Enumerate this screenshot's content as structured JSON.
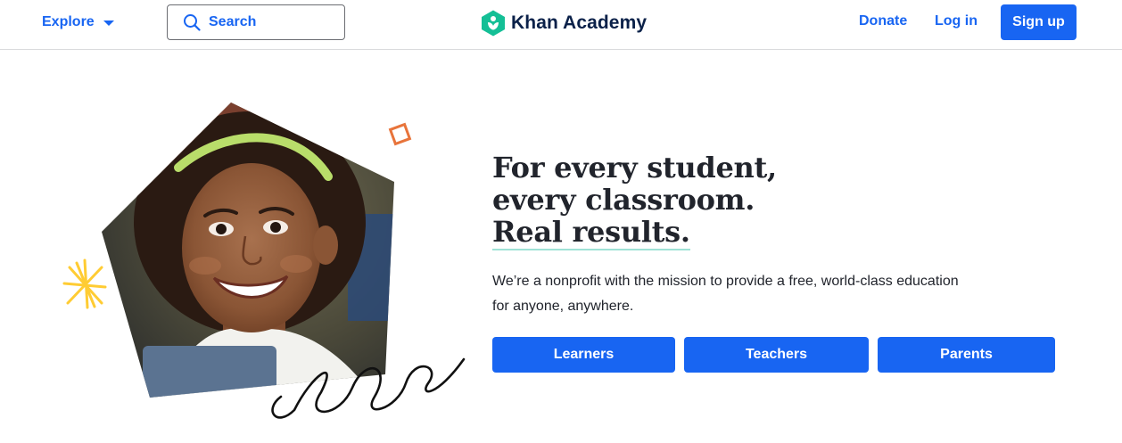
{
  "header": {
    "explore_label": "Explore",
    "search_label": "Search",
    "logo_text": "Khan Academy",
    "donate_label": "Donate",
    "login_label": "Log in",
    "signup_label": "Sign up"
  },
  "hero": {
    "headline_line1": "For every student,",
    "headline_line2": "every classroom.",
    "headline_line3": "Real results.",
    "subtext": "We’re a nonprofit with the mission to provide a free, world-class education for anyone, anywhere.",
    "buttons": {
      "learners": "Learners",
      "teachers": "Teachers",
      "parents": "Parents"
    }
  },
  "icons": {
    "explore_caret": "chevron-down-icon",
    "search": "search-icon",
    "logo": "khan-academy-logo-icon"
  },
  "colors": {
    "brand_blue": "#1865f2",
    "logo_green": "#14bf96",
    "logo_navy": "#0b2149",
    "underline_teal": "#9fe2d6",
    "accent_orange": "#e8743b",
    "accent_yellow": "#ffcc33"
  }
}
